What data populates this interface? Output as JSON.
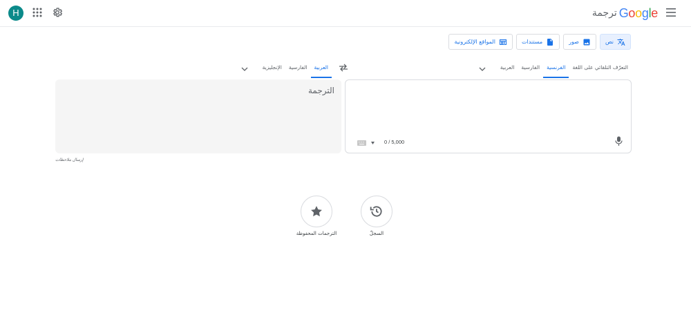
{
  "header": {
    "avatar_letter": "H",
    "logo_text": "Google",
    "logo_suffix": "ترجمة",
    "logo_colors": [
      "#4285F4",
      "#EA4335",
      "#FBBC05",
      "#4285F4",
      "#34A853",
      "#EA4335"
    ]
  },
  "modes": [
    {
      "label": "نص",
      "icon": "translate-icon",
      "active": true
    },
    {
      "label": "صور",
      "icon": "image-icon",
      "active": false
    },
    {
      "label": "مستندات",
      "icon": "document-icon",
      "active": false
    },
    {
      "label": "المواقع الإلكترونية",
      "icon": "web-icon",
      "active": false
    }
  ],
  "source_langs": {
    "tabs": [
      "التعرّف التلقائي على اللغة",
      "الفرنسية",
      "الفارسية",
      "العربية"
    ],
    "active_index": 1
  },
  "target_langs": {
    "tabs": [
      "العربية",
      "الفارسية",
      "الإنجليزية"
    ],
    "active_index": 0
  },
  "source_panel": {
    "counter": "0 / 5,000"
  },
  "target_panel": {
    "placeholder": "الترجمة"
  },
  "feedback_label": "إرسال ملاحظات",
  "bottom": {
    "history_label": "السجلّ",
    "saved_label": "الترجمات المحفوظة"
  },
  "colors": {
    "accent": "#1a73e8",
    "avatar_bg": "#0b8a8a",
    "icon_grey": "#5f6368"
  }
}
